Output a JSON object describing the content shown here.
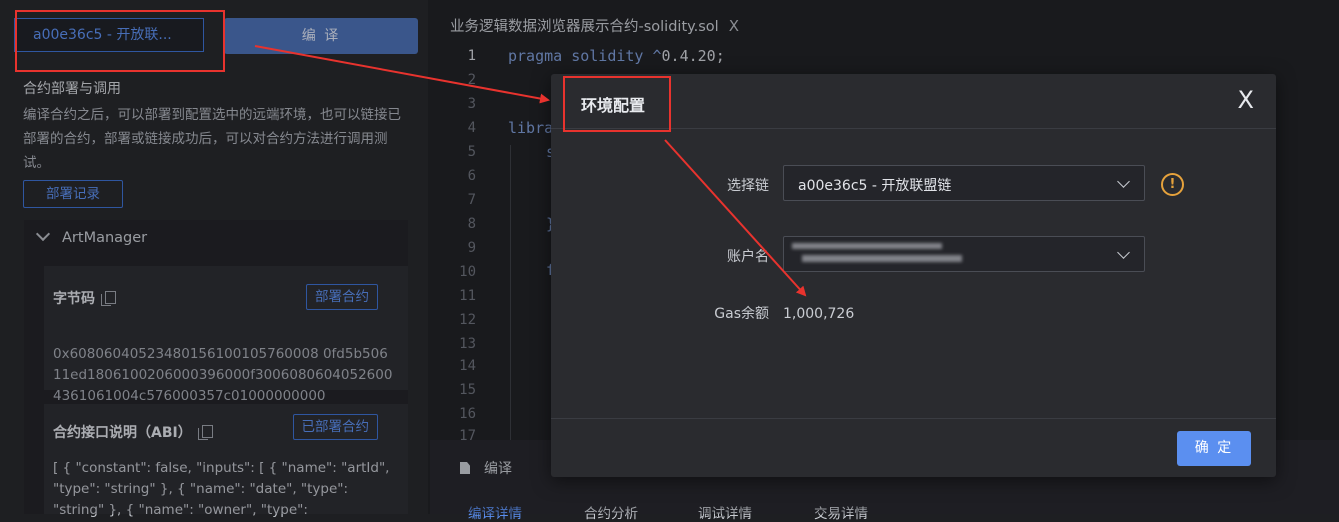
{
  "left_panel": {
    "chain_select": "a00e36c5 - 开放联...",
    "compile_button": "编 译",
    "section_title": "合约部署与调用",
    "section_desc": "编译合约之后，可以部署到配置选中的远端环境，也可以链接已部署的合约，部署或链接成功后，可以对合约方法进行调用测试。",
    "deploy_log_button": "部署记录",
    "contract_name": "ArtManager",
    "bytecode_card": {
      "title": "字节码",
      "button": "部署合约",
      "content": "0x60806040523480156100105760008 0fd5b50611ed1806100206000396000f30060806040526004361061004c576000357c01000000000"
    },
    "abi_card": {
      "title": "合约接口说明（ABI）",
      "button": "已部署合约",
      "content": "[ { \"constant\": false, \"inputs\": [ { \"name\": \"artId\", \"type\": \"string\" }, { \"name\": \"date\", \"type\": \"string\" }, { \"name\": \"owner\", \"type\":"
    }
  },
  "editor": {
    "tab_title": "业务逻辑数据浏览器展示合约-solidity.sol",
    "tab_close": "X",
    "line_numbers": [
      "1",
      "2",
      "3",
      "4",
      "5",
      "6",
      "7",
      "8",
      "9",
      "10",
      "11",
      "12",
      "13",
      "14",
      "15",
      "16",
      "17"
    ],
    "code_line_1_kw": "pragma solidity ^",
    "code_line_1_ver": "0.4.20;",
    "code_line_4": "libra",
    "code_line_5": "s",
    "code_line_9": "}",
    "code_line_10": "f"
  },
  "bottom": {
    "compile_label": "编译",
    "subtabs": [
      "编译详情",
      "合约分析",
      "调试详情",
      "交易详情"
    ]
  },
  "modal": {
    "title": "环境配置",
    "close": "X",
    "chain_label": "选择链",
    "chain_value": "a00e36c5 - 开放联盟链",
    "warn_symbol": "!",
    "account_label": "账户名",
    "gas_label": "Gas余额",
    "gas_value": "1,000,726",
    "ok_button": "确 定"
  },
  "colors": {
    "accent": "#5b8ff0",
    "annotation": "#e8332e",
    "warning": "#e6a23c"
  }
}
